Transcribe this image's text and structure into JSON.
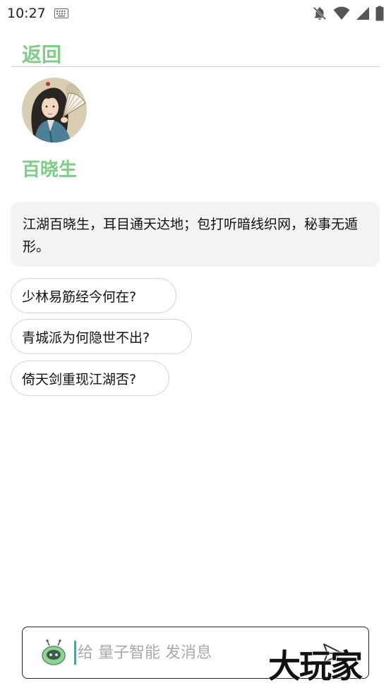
{
  "status_bar": {
    "time": "10:27"
  },
  "header": {
    "back_label": "返回"
  },
  "profile": {
    "name": "百晓生"
  },
  "intro": {
    "text": "江湖百晓生，耳目通天达地；包打听暗线织网，秘事无遁形。"
  },
  "suggestions": [
    "少林易筋经今何在?",
    "青城派为何隐世不出?",
    "倚天剑重现江湖否?"
  ],
  "composer": {
    "placeholder": "给 量子智能 发消息"
  },
  "watermark": {
    "text": "大玩家"
  },
  "colors": {
    "accent": "#7fcc86",
    "caret": "#27b5a6",
    "bubble": "#f3f3f3"
  }
}
